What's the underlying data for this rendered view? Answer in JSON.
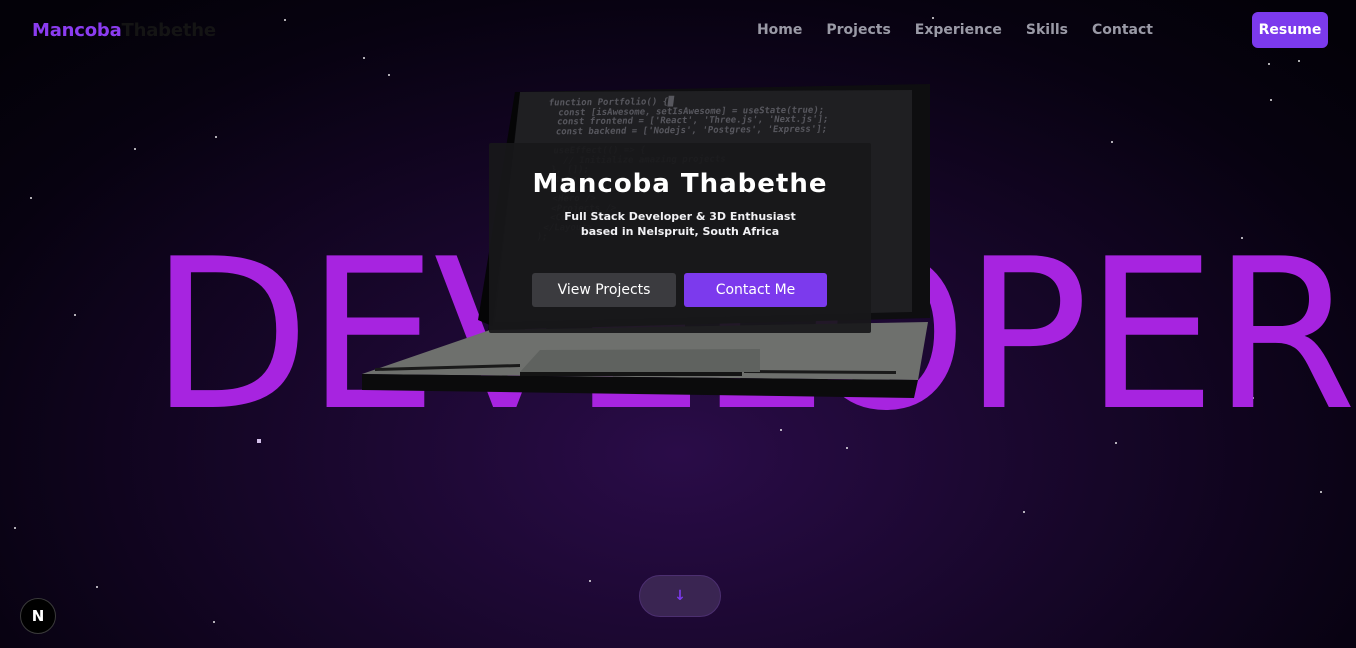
{
  "nav": {
    "logo_first": "Mancoba",
    "logo_last": "Thabethe",
    "links": [
      {
        "label": "Home"
      },
      {
        "label": "Projects"
      },
      {
        "label": "Experience"
      },
      {
        "label": "Skills"
      },
      {
        "label": "Contact"
      }
    ],
    "resume_label": "Resume"
  },
  "background_word": "DEVELOPER",
  "laptop_code": "function Portfolio() {█\n  const [isAwesome, setIsAwesome] = useState(true);\n  const frontend = ['React', 'Three.js', 'Next.js'];\n  const backend = ['Nodejs', 'Postgres', 'Express'];\n\n  useEffect(() => {\n    // Initialize amazing projects\n  }, []);\n return (\n  <Layout>\n   <Hero />\n   <Projects />\n   <Contact />\n  </Layout>\n );",
  "hero": {
    "name": "Mancoba Thabethe",
    "subtitle_line1": "Full Stack Developer & 3D Enthusiast",
    "subtitle_line2": "based in Nelspruit, South Africa",
    "view_projects_label": "View Projects",
    "contact_label": "Contact Me"
  },
  "scroll_icon": "arrow-down-icon",
  "next_badge": "N",
  "colors": {
    "accent": "#7c3aed",
    "big_word": "#a724e0",
    "background": "#160628"
  }
}
